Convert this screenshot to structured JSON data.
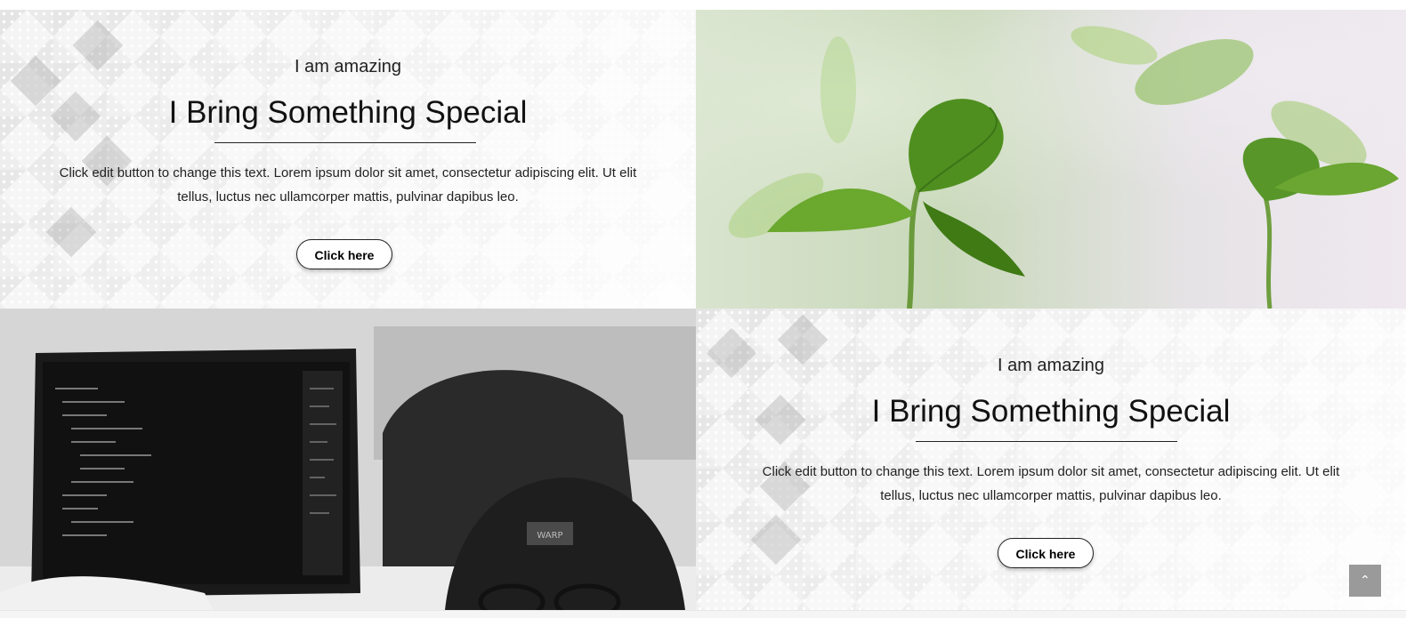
{
  "sections": [
    {
      "eyebrow": "I am amazing",
      "title": "I Bring Something Special",
      "text_line1": "Click edit button to change this text. Lorem ipsum dolor sit amet, consectetur adipiscing elit. Ut elit",
      "text_line2": "tellus, luctus nec ullamcorper mattis, pulvinar dapibus leo.",
      "button_label": "Click here"
    },
    {
      "eyebrow": "I am amazing",
      "title": "I Bring Something Special",
      "text_line1": "Click edit button to change this text. Lorem ipsum dolor sit amet, consectetur adipiscing elit. Ut elit",
      "text_line2": "tellus, luctus nec ullamcorper mattis, pulvinar dapibus leo.",
      "button_label": "Click here"
    }
  ],
  "images": {
    "plant": "plant-seedling-photo",
    "laptop": "laptop-code-photo"
  },
  "scroll_top_icon": "chevron-up-icon",
  "scroll_top_glyph": "⌃",
  "laptop_cap_label": "WARP"
}
